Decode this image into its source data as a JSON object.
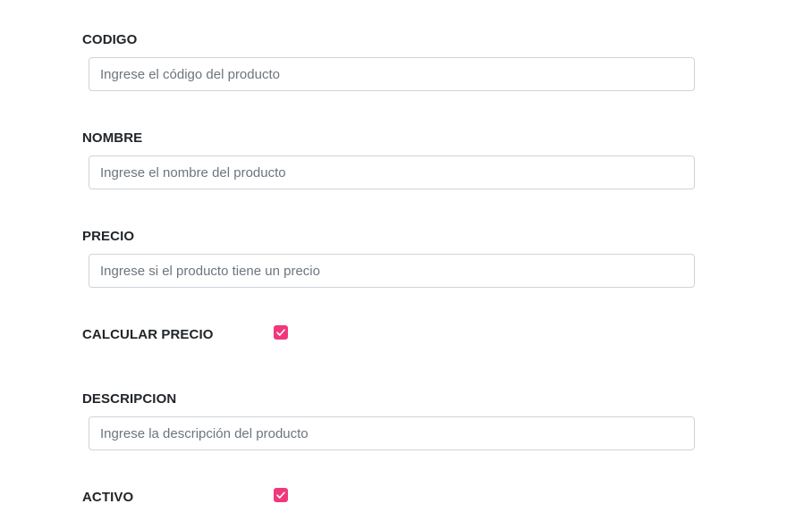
{
  "fields": {
    "codigo": {
      "label": "CODIGO",
      "placeholder": "Ingrese el código del producto",
      "value": ""
    },
    "nombre": {
      "label": "NOMBRE",
      "placeholder": "Ingrese el nombre del producto",
      "value": ""
    },
    "precio": {
      "label": "PRECIO",
      "placeholder": "Ingrese si el producto tiene un precio",
      "value": ""
    },
    "calcular_precio": {
      "label": "CALCULAR PRECIO",
      "checked": true
    },
    "descripcion": {
      "label": "DESCRIPCION",
      "placeholder": "Ingrese la descripción del producto",
      "value": ""
    },
    "activo": {
      "label": "ACTIVO",
      "checked": true
    }
  },
  "colors": {
    "checkbox_accent": "#f0397c",
    "label_text": "#212529",
    "input_border": "#ced4da",
    "placeholder": "#6c757d"
  },
  "icons": {
    "checkbox_check": "check-icon"
  }
}
